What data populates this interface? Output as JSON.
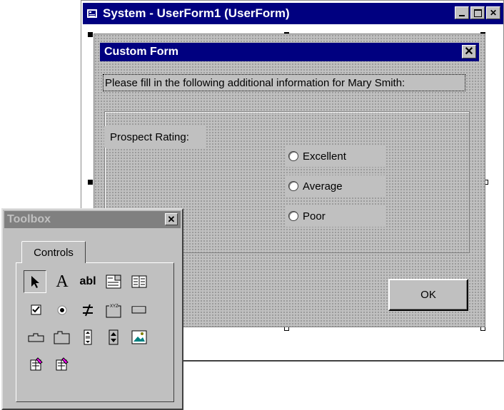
{
  "designer": {
    "title": "System - UserForm1 (UserForm)",
    "buttons": {
      "minimize": "",
      "maximize": "",
      "close": "✕"
    }
  },
  "form": {
    "title": "Custom Form",
    "close_glyph": "✕",
    "intro_text": "Please fill in the following additional information for Mary Smith:",
    "prospect_label": "Prospect Rating:",
    "options": [
      "Excellent",
      "Average",
      "Poor"
    ],
    "ok_label": "OK"
  },
  "toolbox": {
    "title": "Toolbox",
    "close_glyph": "✕",
    "tab_label": "Controls",
    "label_tool_glyph": "A",
    "textbox_tool_glyph": "abl",
    "tools": [
      "pointer-icon",
      "label-icon",
      "textbox-icon",
      "combobox-icon",
      "listbox-icon",
      "checkbox-icon",
      "optionbutton-icon",
      "togglebutton-icon",
      "frame-icon",
      "commandbutton-icon",
      "tabstrip-icon",
      "multipage-icon",
      "scrollbar-icon",
      "spinbutton-icon",
      "image-icon",
      "refedit-icon",
      "custom-control-icon"
    ]
  },
  "colors": {
    "active_title": "#000080",
    "inactive_title": "#808080",
    "face": "#c0c0c0"
  }
}
